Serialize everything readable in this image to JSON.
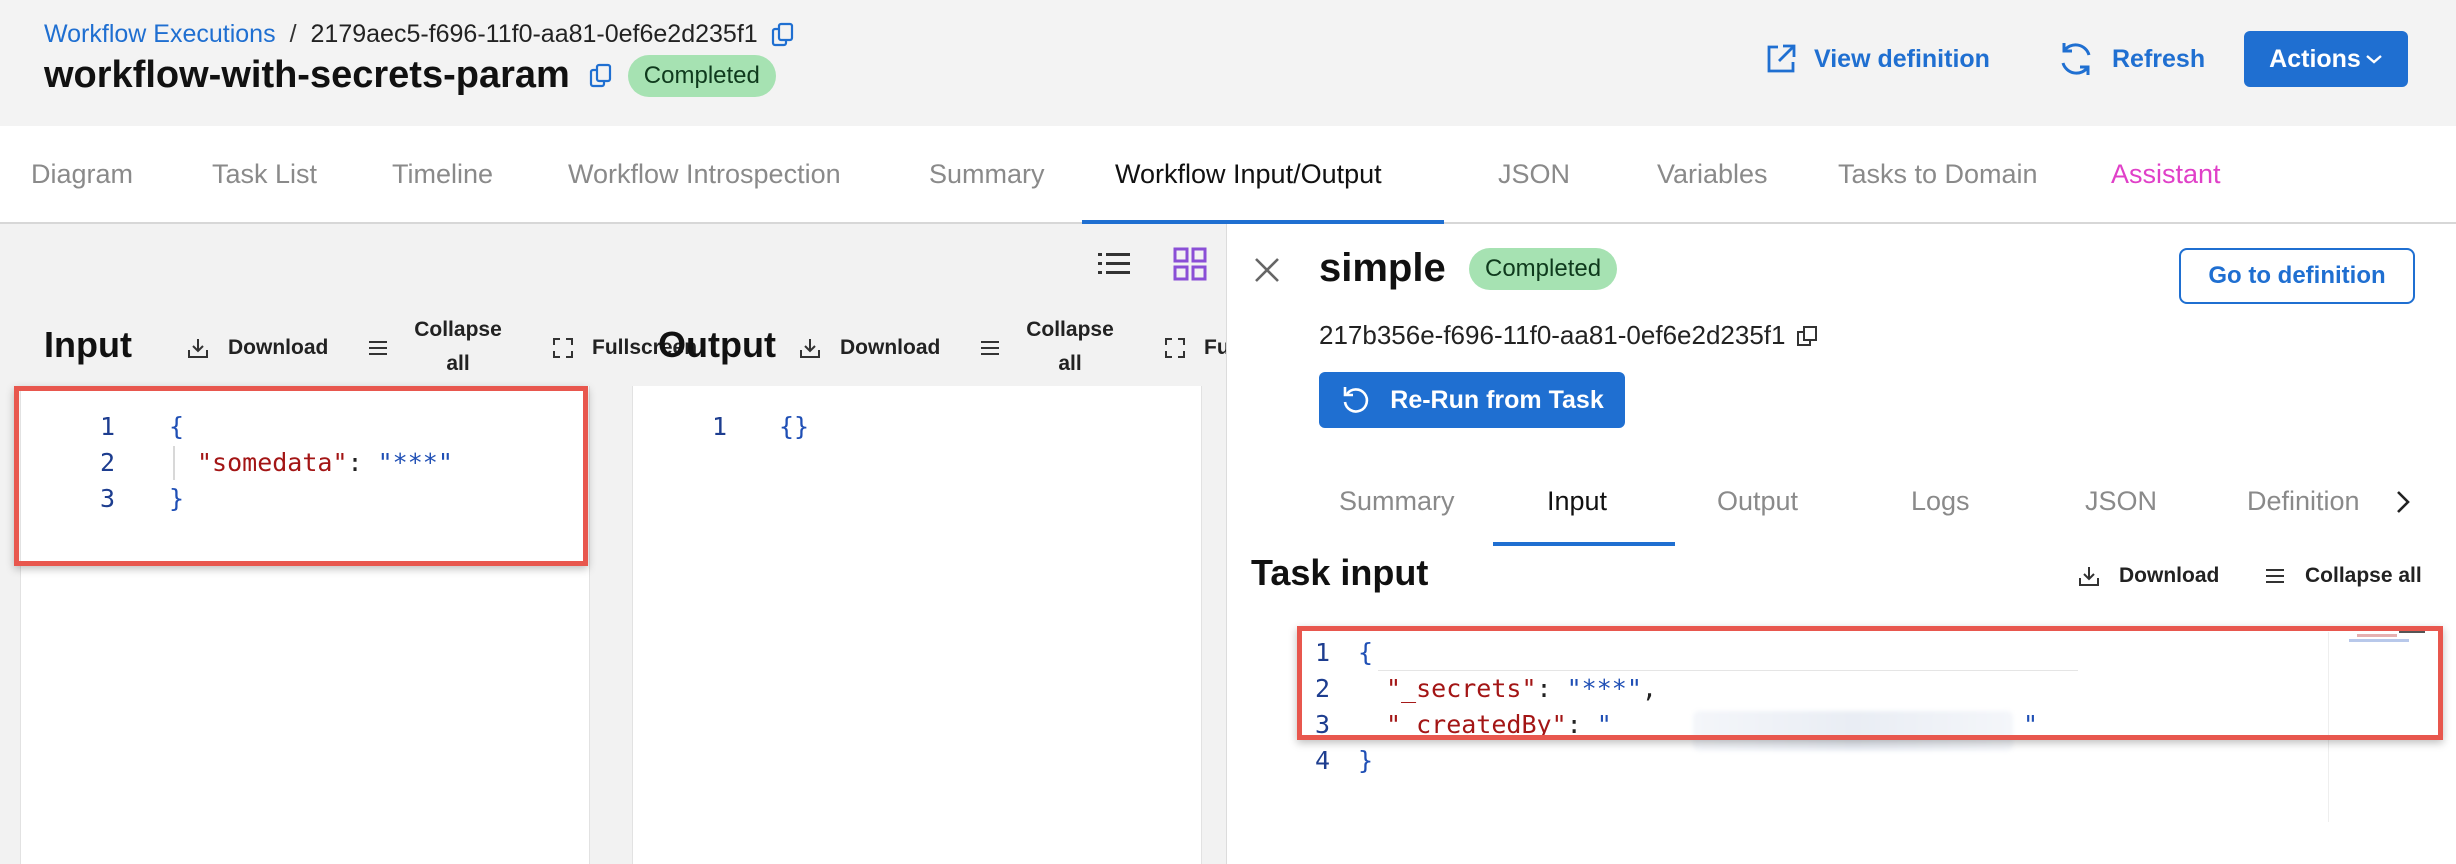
{
  "header": {
    "breadcrumb_link": "Workflow Executions",
    "breadcrumb_sep": "/",
    "execution_id": "2179aec5-f696-11f0-aa81-0ef6e2d235f1",
    "title": "workflow-with-secrets-param",
    "status": "Completed",
    "view_definition": "View definition",
    "refresh": "Refresh",
    "actions": "Actions"
  },
  "tabs": [
    {
      "label": "Diagram"
    },
    {
      "label": "Task List"
    },
    {
      "label": "Timeline"
    },
    {
      "label": "Workflow Introspection"
    },
    {
      "label": "Summary"
    },
    {
      "label": "Workflow Input/Output",
      "active": true
    },
    {
      "label": "JSON"
    },
    {
      "label": "Variables"
    },
    {
      "label": "Tasks to Domain"
    },
    {
      "label": "Assistant"
    }
  ],
  "input_panel": {
    "label": "Input",
    "download": "Download",
    "collapse_line1": "Collapse",
    "collapse_line2": "all",
    "fullscreen": "Fullscreen",
    "lines": [
      "1",
      "2",
      "3"
    ],
    "code": {
      "open": "{",
      "key": "\"somedata\"",
      "colon": ": ",
      "value": "\"***\"",
      "close": "}"
    }
  },
  "output_panel": {
    "label": "Output",
    "download": "Download",
    "collapse_line1": "Collapse",
    "collapse_line2": "all",
    "fullscreen": "Fu",
    "lines": [
      "1"
    ],
    "code": "{}"
  },
  "task_drawer": {
    "name": "simple",
    "status": "Completed",
    "go_to_definition": "Go to definition",
    "task_id": "217b356e-f696-11f0-aa81-0ef6e2d235f1",
    "rerun": "Re-Run from Task",
    "tabs": [
      {
        "label": "Summary"
      },
      {
        "label": "Input",
        "active": true
      },
      {
        "label": "Output"
      },
      {
        "label": "Logs"
      },
      {
        "label": "JSON"
      },
      {
        "label": "Definition"
      }
    ],
    "section_title": "Task input",
    "download": "Download",
    "collapse_all": "Collapse all",
    "lines": [
      "1",
      "2",
      "3",
      "4"
    ],
    "code": {
      "open": "{",
      "secrets_key": "\"_secrets\"",
      "secrets_val": "\"***\"",
      "created_key": "\"_createdBy\"",
      "quote": "\"",
      "close": "}"
    }
  },
  "colors": {
    "accent": "#1f6fd1",
    "status_green": "#a6e2b2",
    "highlight_red": "#e8574e",
    "assistant_pink": "#e040c8"
  }
}
